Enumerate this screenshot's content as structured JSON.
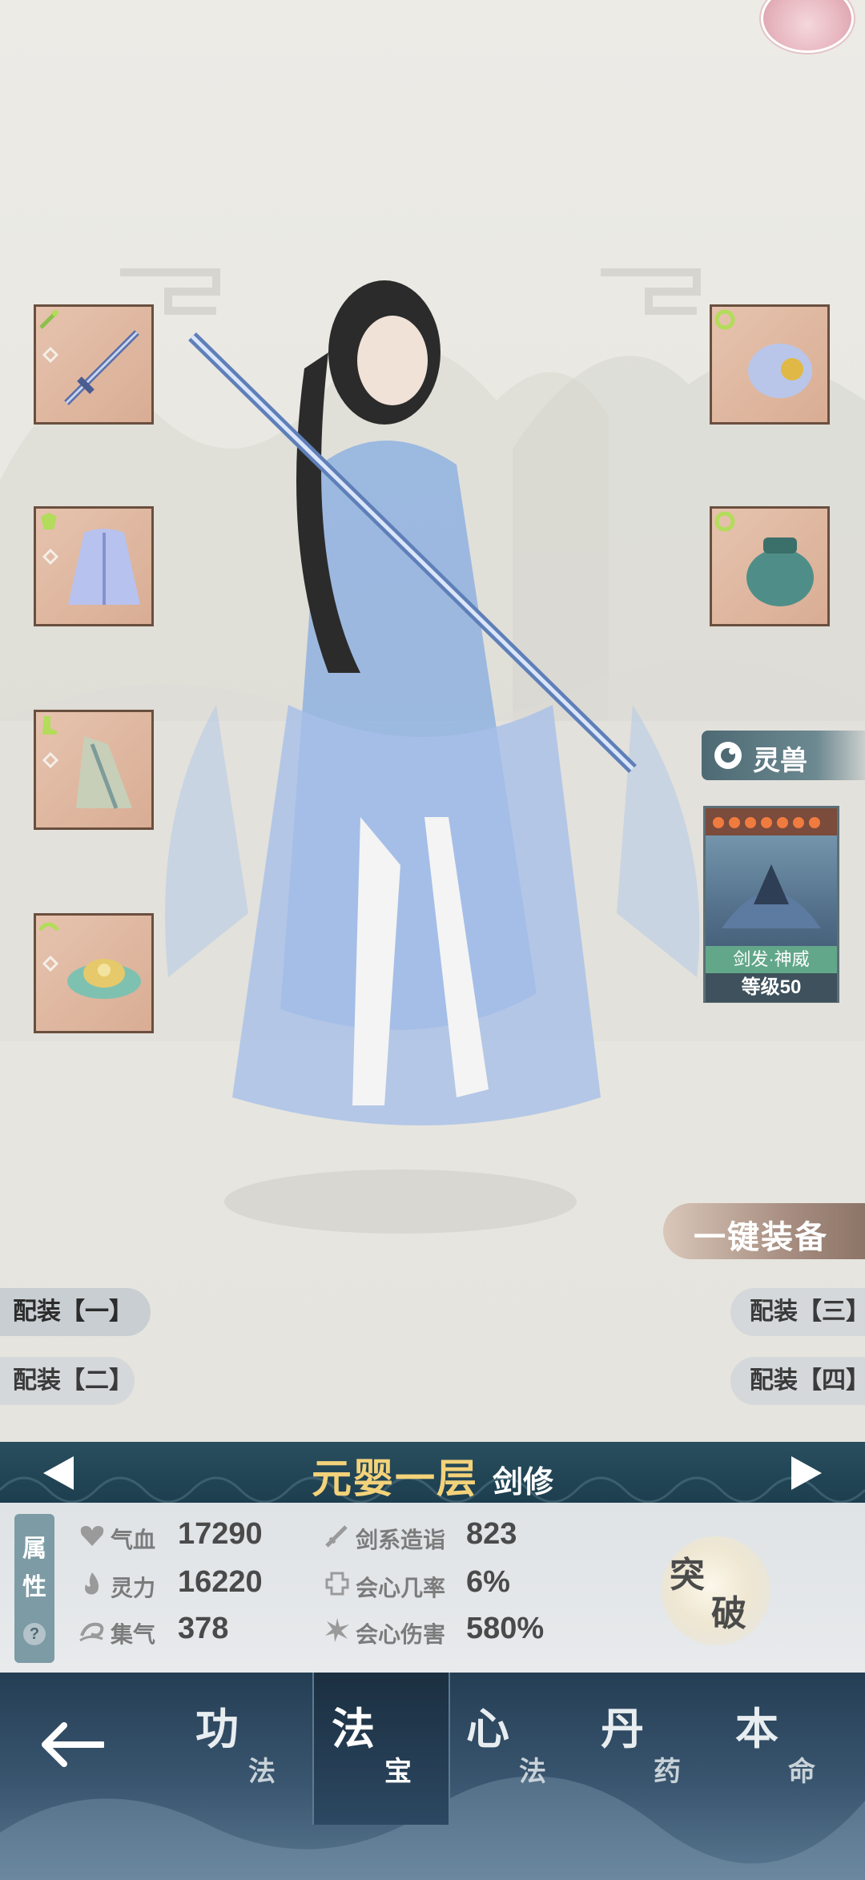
{
  "pet": {
    "tab_label": "灵兽",
    "name": "剑发·神威",
    "level": "等级50"
  },
  "actions": {
    "one_key_equip": "一键装备"
  },
  "loadouts": [
    {
      "label": "配装【一】",
      "active": true
    },
    {
      "label": "配装【二】",
      "active": false
    },
    {
      "label": "配装【三】",
      "active": false
    },
    {
      "label": "配装【四】",
      "active": false
    }
  ],
  "realm": {
    "stage": "元婴一层",
    "path": "剑修"
  },
  "attributes": {
    "tab_label_1": "属",
    "tab_label_2": "性",
    "help": "?",
    "stats": [
      {
        "icon": "heart-icon",
        "label": "气血",
        "value": "17290"
      },
      {
        "icon": "flame-icon",
        "label": "灵力",
        "value": "16220"
      },
      {
        "icon": "swirl-icon",
        "label": "集气",
        "value": "378"
      },
      {
        "icon": "sword-icon",
        "label": "剑系造诣",
        "value": "823"
      },
      {
        "icon": "shield-icon",
        "label": "会心几率",
        "value": "6%"
      },
      {
        "icon": "burst-icon",
        "label": "会心伤害",
        "value": "580%"
      }
    ],
    "breakthrough_1": "突",
    "breakthrough_2": "破"
  },
  "nav": {
    "items": [
      {
        "big": "功",
        "small": "法",
        "active": false
      },
      {
        "big": "法",
        "small": "宝",
        "active": true
      },
      {
        "big": "心",
        "small": "法",
        "active": false
      },
      {
        "big": "丹",
        "small": "药",
        "active": false
      },
      {
        "big": "本",
        "small": "命",
        "active": false
      }
    ]
  },
  "colors": {
    "realm_gold": "#f3d27a",
    "realm_bar": "#1d3e4e",
    "pet_name_bg": "#63a78a",
    "slot_border": "#6a4f3f"
  }
}
